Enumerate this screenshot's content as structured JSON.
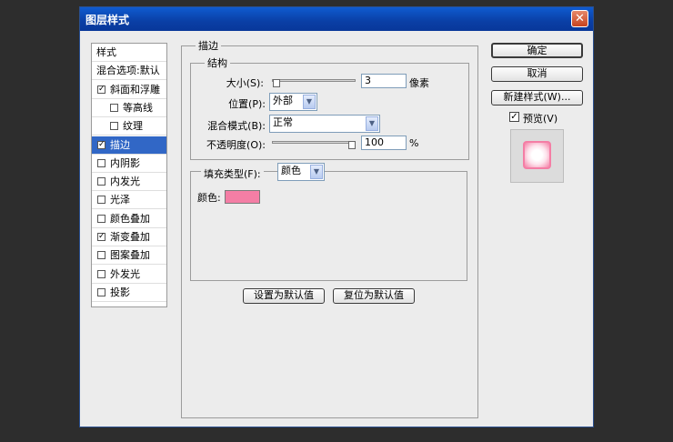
{
  "dialog": {
    "title": "图层样式",
    "close_glyph": "✕"
  },
  "style_list": {
    "items": [
      {
        "label": "样式",
        "checkbox": false,
        "checked": false,
        "indent": false,
        "selected": false
      },
      {
        "label": "混合选项:默认",
        "checkbox": false,
        "checked": false,
        "indent": false,
        "selected": false
      },
      {
        "label": "斜面和浮雕",
        "checkbox": true,
        "checked": true,
        "indent": false,
        "selected": false
      },
      {
        "label": "等高线",
        "checkbox": true,
        "checked": false,
        "indent": true,
        "selected": false
      },
      {
        "label": "纹理",
        "checkbox": true,
        "checked": false,
        "indent": true,
        "selected": false
      },
      {
        "label": "描边",
        "checkbox": true,
        "checked": true,
        "indent": false,
        "selected": true
      },
      {
        "label": "内阴影",
        "checkbox": true,
        "checked": false,
        "indent": false,
        "selected": false
      },
      {
        "label": "内发光",
        "checkbox": true,
        "checked": false,
        "indent": false,
        "selected": false
      },
      {
        "label": "光泽",
        "checkbox": true,
        "checked": false,
        "indent": false,
        "selected": false
      },
      {
        "label": "颜色叠加",
        "checkbox": true,
        "checked": false,
        "indent": false,
        "selected": false
      },
      {
        "label": "渐变叠加",
        "checkbox": true,
        "checked": true,
        "indent": false,
        "selected": false
      },
      {
        "label": "图案叠加",
        "checkbox": true,
        "checked": false,
        "indent": false,
        "selected": false
      },
      {
        "label": "外发光",
        "checkbox": true,
        "checked": false,
        "indent": false,
        "selected": false
      },
      {
        "label": "投影",
        "checkbox": true,
        "checked": false,
        "indent": false,
        "selected": false
      }
    ],
    "check_glyph": "✓"
  },
  "stroke": {
    "section_title": "描边",
    "structure_title": "结构",
    "size_label": "大小(S):",
    "size_value": "3",
    "size_unit": "像素",
    "size_level": 0.01,
    "position_label": "位置(P):",
    "position_value": "外部",
    "blend_label": "混合模式(B):",
    "blend_value": "正常",
    "opacity_label": "不透明度(O):",
    "opacity_value": "100",
    "opacity_unit": "%",
    "opacity_level": 1.0,
    "fill_type_label": "填充类型(F):",
    "fill_type_value": "颜色",
    "color_label": "颜色:",
    "color_swatch": "#f47ea5",
    "set_default_label": "设置为默认值",
    "reset_default_label": "复位为默认值"
  },
  "actions": {
    "ok_label": "确定",
    "cancel_label": "取消",
    "new_style_label": "新建样式(W)...",
    "preview_label": "预览(V)",
    "preview_checked": true
  },
  "colors": {
    "selected_row": "#3167c6",
    "preview_pink": "#f47ea5"
  },
  "icons": {
    "dropdown": "▼"
  }
}
